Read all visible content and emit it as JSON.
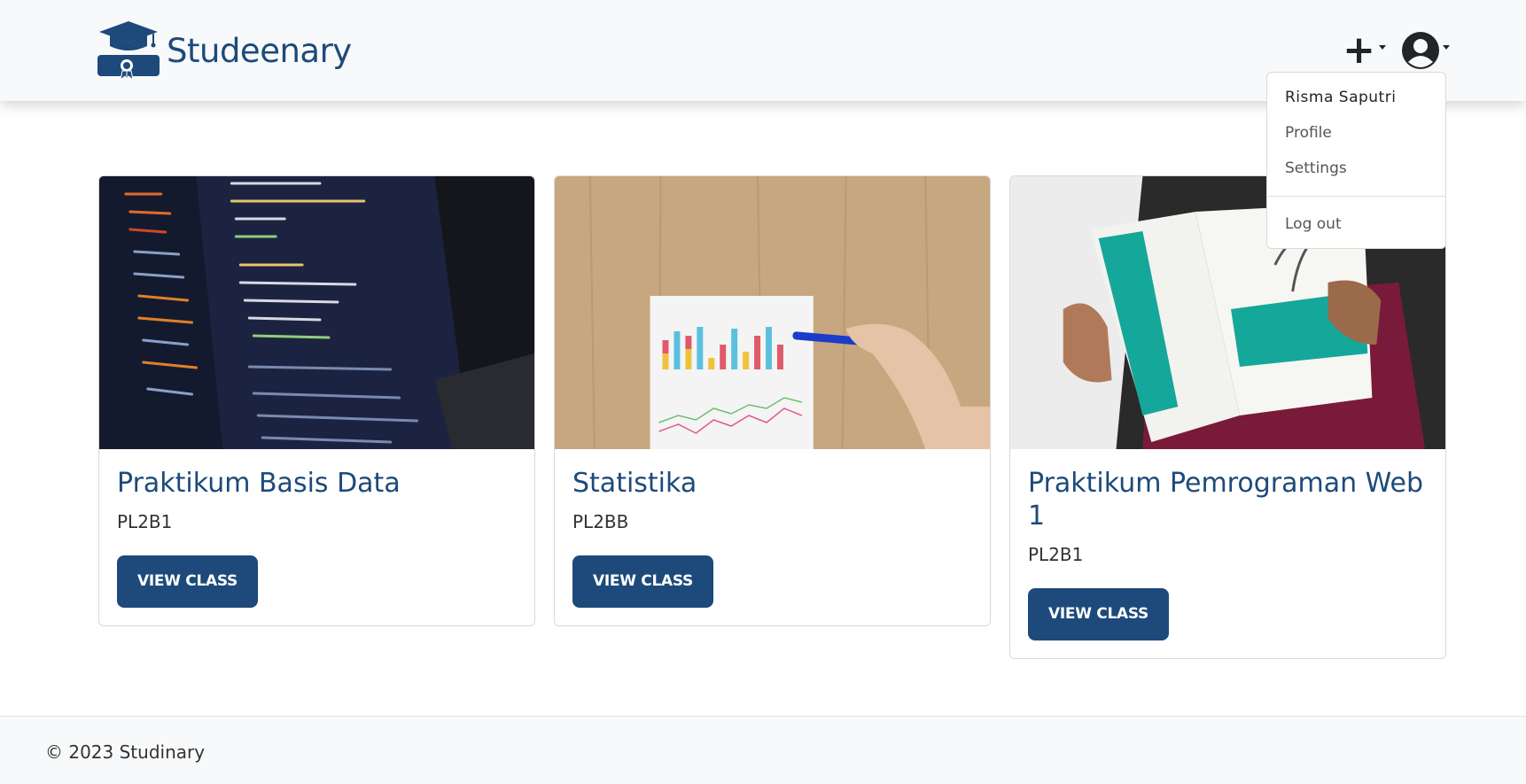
{
  "brand": {
    "name": "Studeenary",
    "logo_icon": "graduation-cap-diploma-icon",
    "color": "#1d4a7a"
  },
  "nav": {
    "add_icon": "plus-icon",
    "user_icon": "user-circle-icon"
  },
  "user_menu": {
    "name": "Risma Saputri",
    "items": [
      "Profile",
      "Settings"
    ],
    "logout": "Log out"
  },
  "classes": [
    {
      "title": "Praktikum Basis Data",
      "code": "PL2B1",
      "button": "VIEW CLASS",
      "image": "laptop-code-editor-photo"
    },
    {
      "title": "Statistika",
      "code": "PL2BB",
      "button": "VIEW CLASS",
      "image": "chart-paper-on-wood-photo"
    },
    {
      "title": "Praktikum Pemrograman Web 1",
      "code": "PL2B1",
      "button": "VIEW CLASS",
      "image": "dynamic-html-book-photo"
    }
  ],
  "footer": {
    "text": "© 2023 Studinary"
  },
  "colors": {
    "primary": "#1d4a7a",
    "navbar_bg": "#f8f9fa"
  }
}
